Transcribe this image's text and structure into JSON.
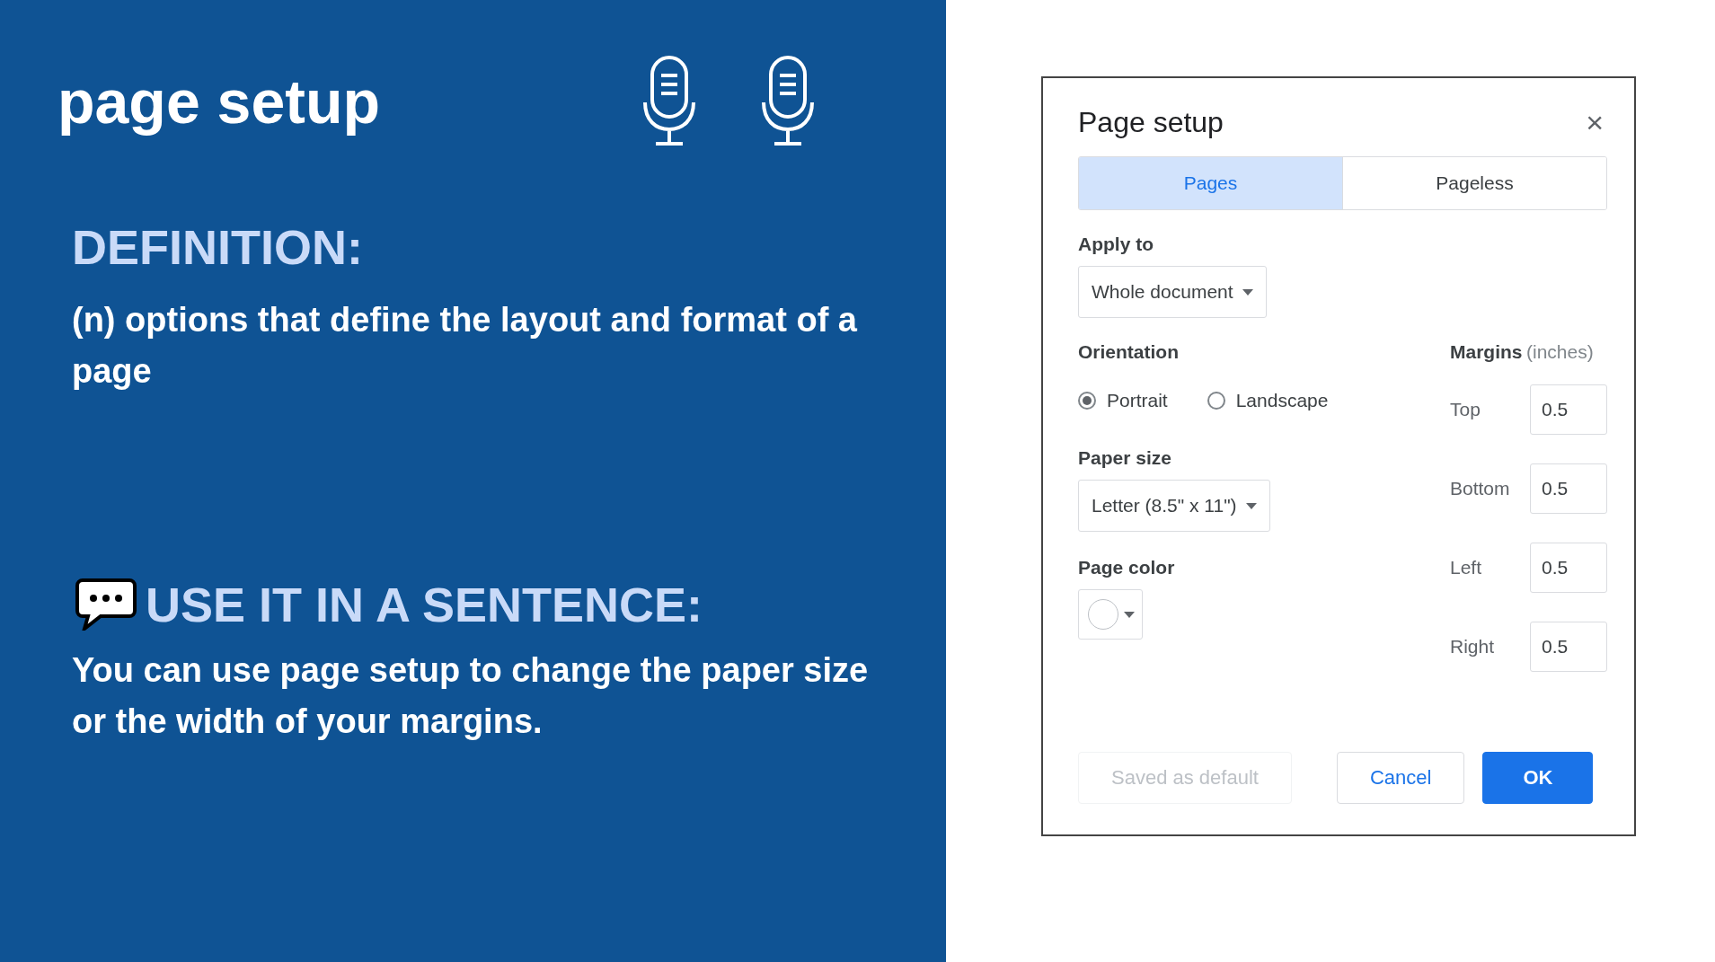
{
  "slide": {
    "title": "page setup",
    "definition_heading": "DEFINITION:",
    "definition": "(n) options that define the layout and format of a page",
    "sentence_heading": "USE IT IN A SENTENCE:",
    "sentence": "You can use page setup to change the paper size or the width of your margins."
  },
  "dialog": {
    "title": "Page setup",
    "close": "×",
    "tabs": [
      {
        "label": "Pages",
        "selected": true
      },
      {
        "label": "Pageless",
        "selected": false
      }
    ],
    "apply_to": {
      "label": "Apply to",
      "value": "Whole document"
    },
    "orientation": {
      "label": "Orientation",
      "options": [
        {
          "label": "Portrait",
          "selected": true
        },
        {
          "label": "Landscape",
          "selected": false
        }
      ]
    },
    "paper_size": {
      "label": "Paper size",
      "value": "Letter (8.5\" x 11\")"
    },
    "page_color": {
      "label": "Page color"
    },
    "margins": {
      "label": "Margins",
      "unit": "(inches)",
      "fields": [
        {
          "label": "Top",
          "value": "0.5"
        },
        {
          "label": "Bottom",
          "value": "0.5"
        },
        {
          "label": "Left",
          "value": "0.5"
        },
        {
          "label": "Right",
          "value": "0.5"
        }
      ]
    },
    "buttons": [
      {
        "label": "Saved as default",
        "kind": "disabled"
      },
      {
        "label": "Cancel",
        "kind": "outline"
      },
      {
        "label": "OK",
        "kind": "primary"
      }
    ]
  }
}
